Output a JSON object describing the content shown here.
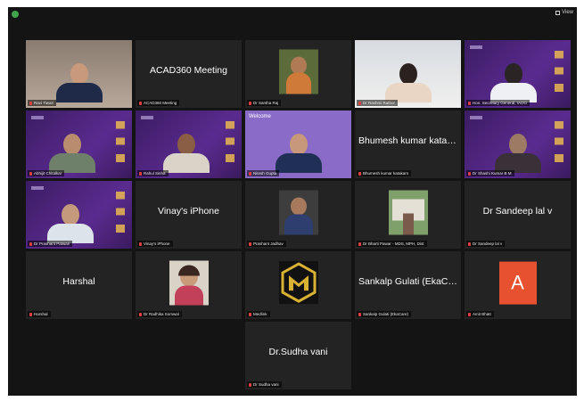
{
  "toolbar": {
    "view_label": "View"
  },
  "colors": {
    "avatar_accent": "#e8512f",
    "brand_purple": "#4b2478",
    "mic_muted": "#e04040"
  },
  "tiles": [
    {
      "id": "r1c1",
      "name": "Ravi Tiwari",
      "center": ""
    },
    {
      "id": "r1c2",
      "name": "ACAD360 Meeting",
      "center": "ACAD360 Meeting"
    },
    {
      "id": "r1c3",
      "name": "Dr Santha Raj",
      "center": ""
    },
    {
      "id": "r1c4",
      "name": "Dr Rashmi Rathor",
      "center": ""
    },
    {
      "id": "r1c5",
      "name": "Hon. Secretary General, IAOO",
      "center": ""
    },
    {
      "id": "r2c1",
      "name": "Abhijit Chitalkar",
      "center": ""
    },
    {
      "id": "r2c2",
      "name": "Rahul Sinha",
      "center": ""
    },
    {
      "id": "r2c3",
      "name": "Nitesh Gupta",
      "center": "",
      "overlay": "Welcome"
    },
    {
      "id": "r2c4",
      "name": "Bhumesh kumar katakam",
      "center": "Bhumesh kumar kataka..."
    },
    {
      "id": "r2c5",
      "name": "Dr Shashi Kumar B M",
      "center": ""
    },
    {
      "id": "r3c1",
      "name": "Dr Prashant Patwari",
      "center": ""
    },
    {
      "id": "r3c2",
      "name": "Vinay's iPhone",
      "center": "Vinay's iPhone"
    },
    {
      "id": "r3c3",
      "name": "Prashant Jadhav",
      "center": ""
    },
    {
      "id": "r3c4",
      "name": "Dr Bharti Pawar - MDS, MPH, Dist",
      "center": ""
    },
    {
      "id": "r3c5",
      "name": "Dr Sandeep lal v",
      "center": "Dr Sandeep lal v"
    },
    {
      "id": "r4c1",
      "name": "Harshal",
      "center": "Harshal"
    },
    {
      "id": "r4c2",
      "name": "Dr Radhika Somwal",
      "center": ""
    },
    {
      "id": "r4c3",
      "name": "Medlink",
      "center": ""
    },
    {
      "id": "r4c4",
      "name": "Sankalp Gulati (EkaCare)",
      "center": "Sankalp Gulati (EkaCare)"
    },
    {
      "id": "r4c5",
      "name": "Amit Bhatt",
      "center": "",
      "avatar_letter": "A"
    },
    {
      "id": "r5c3",
      "name": "Dr Sudha vani",
      "center": "Dr.Sudha vani"
    }
  ]
}
